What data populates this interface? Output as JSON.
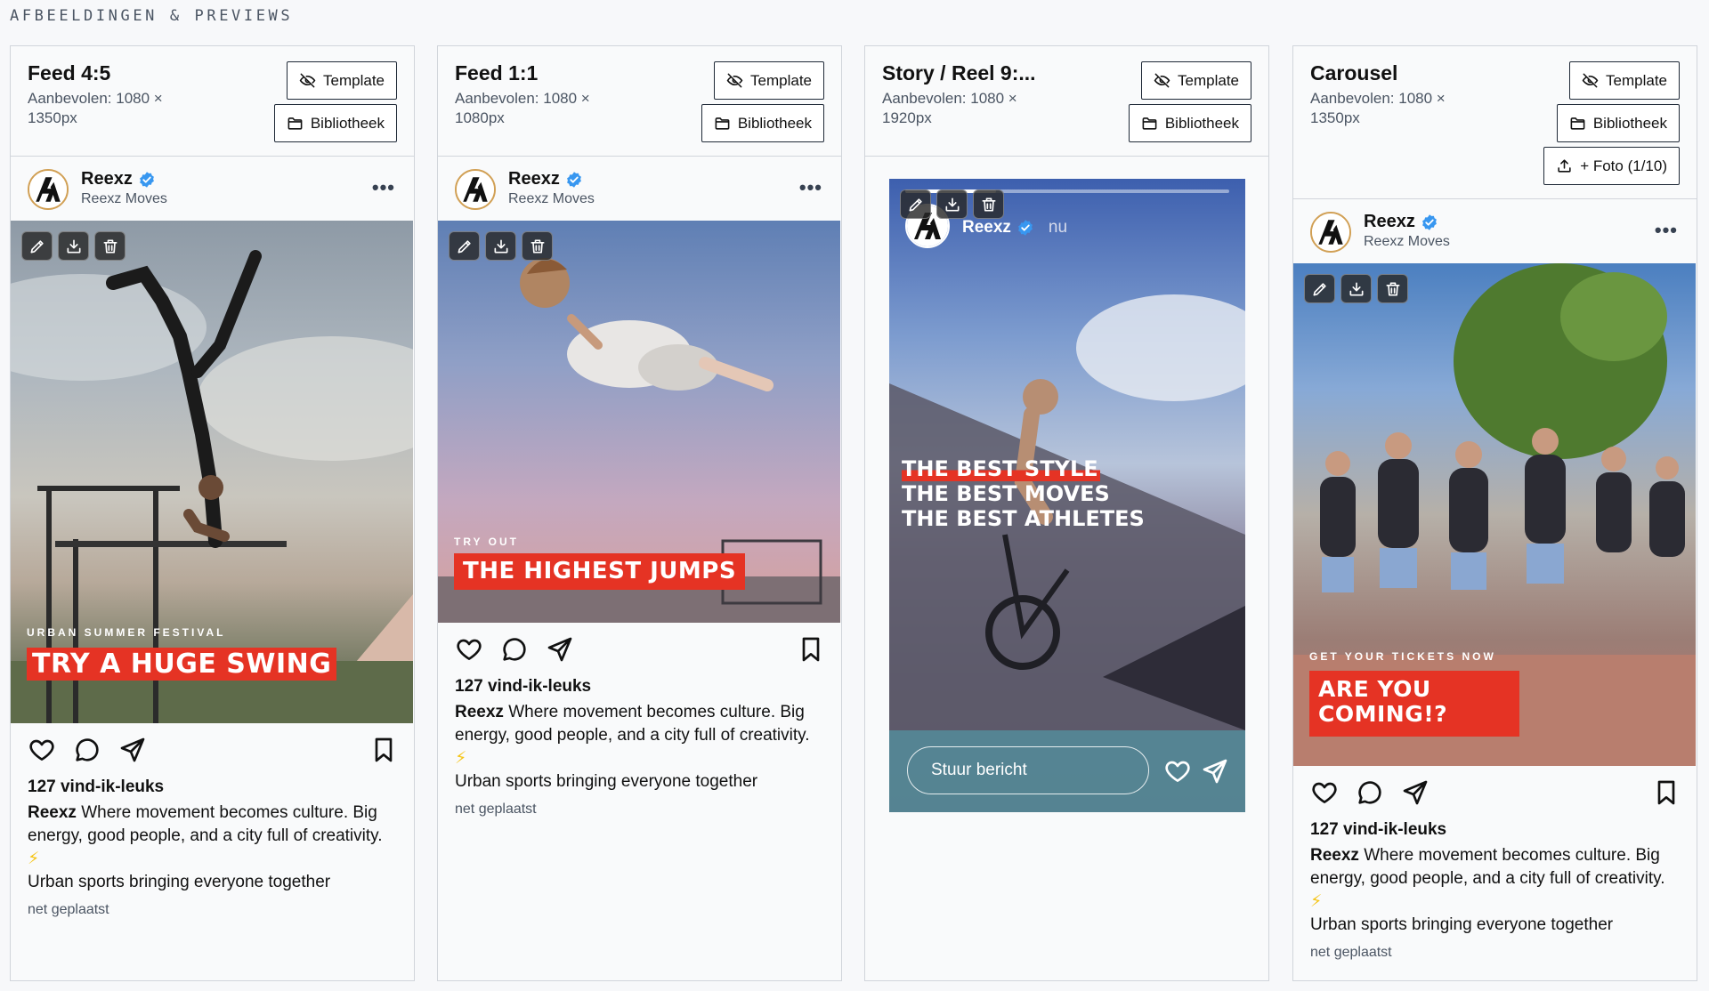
{
  "section_title": "AFBEELDINGEN & PREVIEWS",
  "buttons": {
    "template": "Template",
    "library": "Bibliotheek",
    "add_photo": "+ Foto (1/10)"
  },
  "account": {
    "name": "Reexz",
    "subtitle": "Reexz Moves"
  },
  "post": {
    "likes": "127 vind-ik-leuks",
    "caption_name": "Reexz",
    "caption_text": "Where movement becomes culture. Big energy, good people, and a city full of creativity.",
    "caption_emoji": "⚡",
    "caption_line2": "Urban sports bringing everyone together",
    "posted": "net geplaatst"
  },
  "cards": [
    {
      "title": "Feed 4:5",
      "desc": "Aanbevolen: 1080 × 1350px",
      "banner_small": "URBAN SUMMER FESTIVAL",
      "banner_big": "TRY A HUGE SWING"
    },
    {
      "title": "Feed 1:1",
      "desc": "Aanbevolen: 1080 × 1080px",
      "banner_small": "TRY OUT",
      "banner_big": "THE HIGHEST JUMPS"
    },
    {
      "title": "Story / Reel 9:...",
      "desc": "Aanbevolen: 1080 × 1920px",
      "story_time": "nu",
      "story_lines": [
        "THE BEST STYLE",
        "THE BEST MOVES",
        "THE BEST ATHLETES"
      ],
      "message_placeholder": "Stuur bericht"
    },
    {
      "title": "Carousel",
      "desc": "Aanbevolen: 1080 × 1350px",
      "banner_small": "GET YOUR TICKETS NOW",
      "banner_big_1": "ARE YOU",
      "banner_big_2": "COMING!?"
    }
  ],
  "colors": {
    "accent_red": "#e53324",
    "verified_blue": "#3897f0",
    "border": "#d1d5db"
  },
  "icons": [
    "eye-off-icon",
    "folder-icon",
    "upload-icon",
    "pencil-icon",
    "download-icon",
    "trash-icon",
    "heart-icon",
    "comment-icon",
    "send-icon",
    "bookmark-icon",
    "more-icon",
    "verified-icon"
  ]
}
